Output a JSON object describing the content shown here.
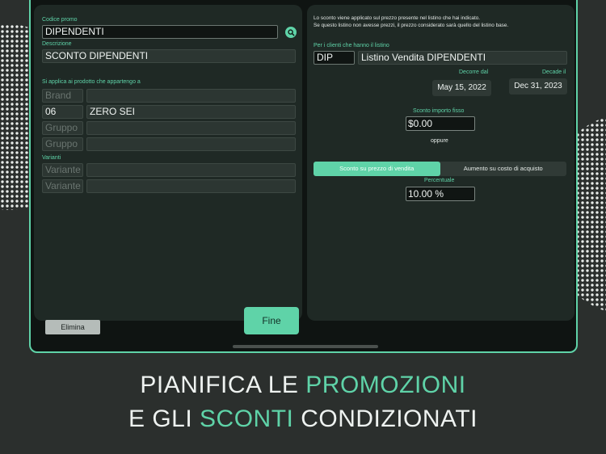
{
  "theme": {
    "accent": "#5fd3a8",
    "background": "#2b2f2d",
    "panel": "#1f2925"
  },
  "left_panel": {
    "promo_code_label": "Codice promo",
    "promo_code_value": "DIPENDENTI",
    "search_icon": "search-icon",
    "description_label": "Descrizione",
    "description_value": "SCONTO DIPENDENTI",
    "applies_label": "Si applica ai prodotto che appartengo a",
    "rows": [
      {
        "code": "",
        "code_placeholder": "Brand",
        "name": ""
      },
      {
        "code": "06",
        "code_placeholder": "",
        "name": "ZERO SEI"
      },
      {
        "code": "",
        "code_placeholder": "Gruppo",
        "name": ""
      },
      {
        "code": "",
        "code_placeholder": "Gruppo",
        "name": ""
      }
    ],
    "variants_label": "Varianti",
    "variants": [
      {
        "code": "",
        "code_placeholder": "Variante",
        "name": ""
      },
      {
        "code": "",
        "code_placeholder": "Variante",
        "name": ""
      }
    ],
    "delete_label": "Elimina",
    "done_label": "Fine"
  },
  "right_panel": {
    "info_line1": "Lo sconto viene applicato sul prezzo presente nel listino che hai indicato.",
    "info_line2": "Se questo listino non avesse prezzi, il prezzo considerato sarà quello del listino base.",
    "pricelist_label": "Per i clienti che hanno il listino",
    "pricelist_code": "DIP",
    "pricelist_name": "Listino Vendita DIPENDENTI",
    "start_label": "Decorre dal",
    "start_date": "May 15, 2022",
    "end_label": "Decade il",
    "end_date": "Dec 31, 2023",
    "fixed_label": "Sconto importo fisso",
    "fixed_value": "$0.00",
    "or_label": "oppure",
    "segments": [
      {
        "label": "Sconto su prezzo di vendita",
        "selected": true
      },
      {
        "label": "Aumento su costo di acquisto",
        "selected": false
      }
    ],
    "percent_label": "Percentuale",
    "percent_value": "10.00 %"
  },
  "headline": {
    "line1_a": "PIANIFICA LE ",
    "line1_b": "PROMOZIONI",
    "line2_a": "E GLI ",
    "line2_b": "SCONTI",
    "line2_c": " CONDIZIONATI"
  }
}
